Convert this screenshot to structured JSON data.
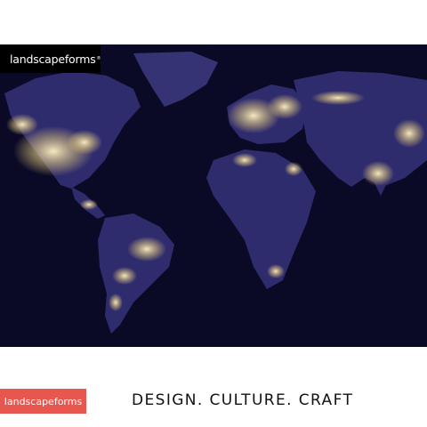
{
  "brand": {
    "top_logo_text": "landscapeforms",
    "top_logo_mark": "®",
    "bottom_logo_text": "landscapeforms",
    "accent_color": "#e8574f"
  },
  "hero": {
    "image": "world-at-night-map",
    "background_color": "#0b0a26",
    "land_color": "#2f2c6e",
    "lights_color": "#ffe9a8"
  },
  "tagline": "DESIGN. CULTURE. CRAFT"
}
